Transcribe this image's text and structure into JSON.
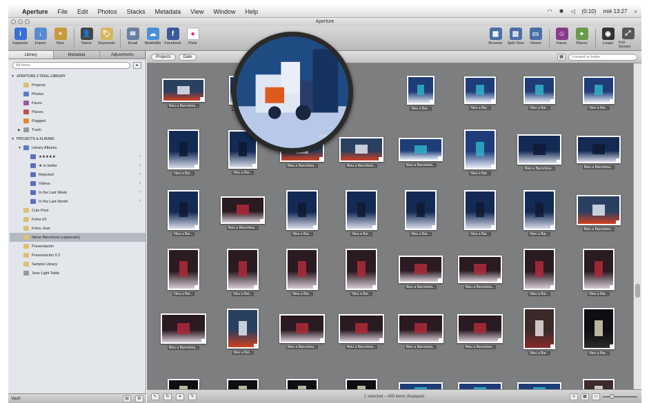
{
  "menubar": {
    "apple": "",
    "items": [
      "Aperture",
      "File",
      "Edit",
      "Photos",
      "Stacks",
      "Metadata",
      "View",
      "Window",
      "Help"
    ],
    "clock": "mié 13:27",
    "status_extra": "(0:10)"
  },
  "window": {
    "title": "Aperture"
  },
  "toolbar": {
    "left": [
      {
        "label": "Inspector",
        "icon": "info-icon",
        "color": "#3a6fd8",
        "glyph": "i"
      },
      {
        "label": "Import",
        "icon": "import-icon",
        "color": "#5a8bd0",
        "glyph": "↓"
      },
      {
        "label": "New",
        "icon": "new-icon",
        "color": "#c79a3a",
        "glyph": "+"
      },
      {
        "label": "Name",
        "icon": "name-icon",
        "color": "#444",
        "glyph": "👤"
      },
      {
        "label": "Keywords",
        "icon": "keywords-icon",
        "color": "#d8b55a",
        "glyph": "🏷"
      },
      {
        "label": "Email",
        "icon": "email-icon",
        "color": "#6a7ea0",
        "glyph": "✉"
      },
      {
        "label": "MobileMe",
        "icon": "mobileme-icon",
        "color": "#4a8fd8",
        "glyph": "☁"
      },
      {
        "label": "Facebook",
        "icon": "facebook-icon",
        "color": "#3b5998",
        "glyph": "f"
      },
      {
        "label": "Flickr",
        "icon": "flickr-icon",
        "color": "#fff",
        "glyph": "●"
      }
    ],
    "right": [
      {
        "label": "Browser",
        "icon": "browser-icon",
        "color": "#4a6fa8",
        "glyph": "▦"
      },
      {
        "label": "Split View",
        "icon": "split-view-icon",
        "color": "#4a6fa8",
        "glyph": "▤"
      },
      {
        "label": "Viewer",
        "icon": "viewer-icon",
        "color": "#4a6fa8",
        "glyph": "▭"
      },
      {
        "label": "Faces",
        "icon": "faces-icon",
        "color": "#8a3a8a",
        "glyph": "☺"
      },
      {
        "label": "Places",
        "icon": "places-icon",
        "color": "#6a9a4a",
        "glyph": "⌖"
      },
      {
        "label": "Loupe",
        "icon": "loupe-icon",
        "color": "#333",
        "glyph": "◉"
      },
      {
        "label": "Full Screen",
        "icon": "full-screen-icon",
        "color": "#555",
        "glyph": "⤢"
      }
    ]
  },
  "sidebar": {
    "tabs": [
      "Library",
      "Metadata",
      "Adjustments"
    ],
    "search_placeholder": "All Items",
    "items": [
      {
        "label": "APERTURE 3 TRIAL LIBRARY",
        "type": "hdr",
        "indent": 0,
        "tri": "▼"
      },
      {
        "label": "Projects",
        "indent": 1,
        "color": "#e0c070"
      },
      {
        "label": "Photos",
        "indent": 1,
        "color": "#5a7fc0"
      },
      {
        "label": "Faces",
        "indent": 1,
        "color": "#9a5aa0"
      },
      {
        "label": "Places",
        "indent": 1,
        "color": "#c05050"
      },
      {
        "label": "Flagged",
        "indent": 1,
        "color": "#e08a30"
      },
      {
        "label": "Trash",
        "indent": 1,
        "color": "#999",
        "tri": "▶"
      },
      {
        "label": "PROJECTS & ALBUMS",
        "type": "hdr",
        "indent": 0,
        "tri": "▼"
      },
      {
        "label": "Library Albums",
        "indent": 1,
        "color": "#5a7fc0",
        "tri": "▼"
      },
      {
        "label": "★★★★★",
        "indent": 2,
        "color": "#5a6fc0",
        "count": "⌕"
      },
      {
        "label": "★ or better",
        "indent": 2,
        "color": "#5a6fc0",
        "count": "⌕"
      },
      {
        "label": "Rejected",
        "indent": 2,
        "color": "#5a6fc0",
        "count": "⌕"
      },
      {
        "label": "Videos",
        "indent": 2,
        "color": "#5a6fc0",
        "count": "⌕"
      },
      {
        "label": "In the Last Week",
        "indent": 2,
        "color": "#5a6fc0",
        "count": "⌕"
      },
      {
        "label": "In the Last Month",
        "indent": 2,
        "color": "#5a6fc0",
        "count": "⌕"
      },
      {
        "label": "Cuts Pizzi",
        "indent": 1,
        "color": "#e0c070"
      },
      {
        "label": "Fotos 03",
        "indent": 1,
        "color": "#e0c070"
      },
      {
        "label": "Fotos Jean",
        "indent": 1,
        "color": "#e0c070"
      },
      {
        "label": "Nieve Barcelona (capturado)",
        "indent": 1,
        "color": "#e0c070",
        "selected": true
      },
      {
        "label": "Presentación",
        "indent": 1,
        "color": "#e0c070"
      },
      {
        "label": "Presentación 0 2",
        "indent": 1,
        "color": "#e0c070"
      },
      {
        "label": "Sample Library",
        "indent": 1,
        "color": "#e0c070"
      },
      {
        "label": "Jean Light Table",
        "indent": 1,
        "color": "#999"
      }
    ],
    "bottom_left": "Vault"
  },
  "browser": {
    "pills": [
      "Projects",
      "Date"
    ],
    "search_placeholder": "Unrated or better",
    "status_text": "1 selected – 465 items displayed",
    "caption_short": "Nieu a Bar...",
    "caption_long": "Nieu a Barcelona...",
    "loupe_zoom": "100%"
  },
  "colors": {
    "sidebar_bg": "#e3e6ea",
    "browser_bg": "#7d7e80",
    "selected_row": "#b5bac2"
  }
}
